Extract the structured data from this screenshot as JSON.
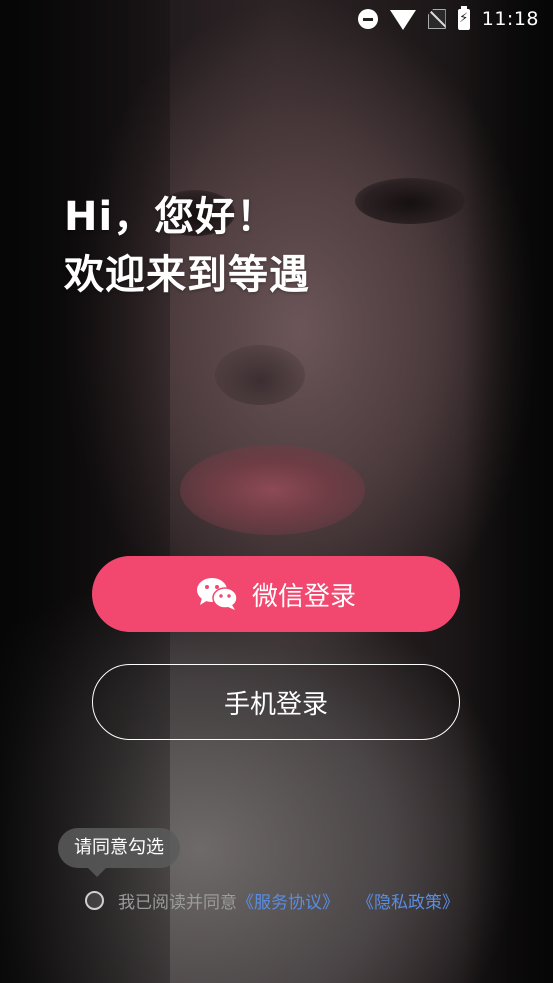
{
  "status_bar": {
    "time": "11:18"
  },
  "greeting": {
    "line1": "Hi，您好！",
    "line2": "欢迎来到等遇"
  },
  "buttons": {
    "wechat_label": "微信登录",
    "phone_label": "手机登录"
  },
  "tooltip": {
    "text": "请同意勾选"
  },
  "agreement": {
    "prefix": "我已阅读并同意",
    "service_link": "《服务协议》",
    "privacy_link": "《隐私政策》",
    "checked": false
  },
  "colors": {
    "primary": "#f2486f",
    "link": "#5a8de0"
  }
}
